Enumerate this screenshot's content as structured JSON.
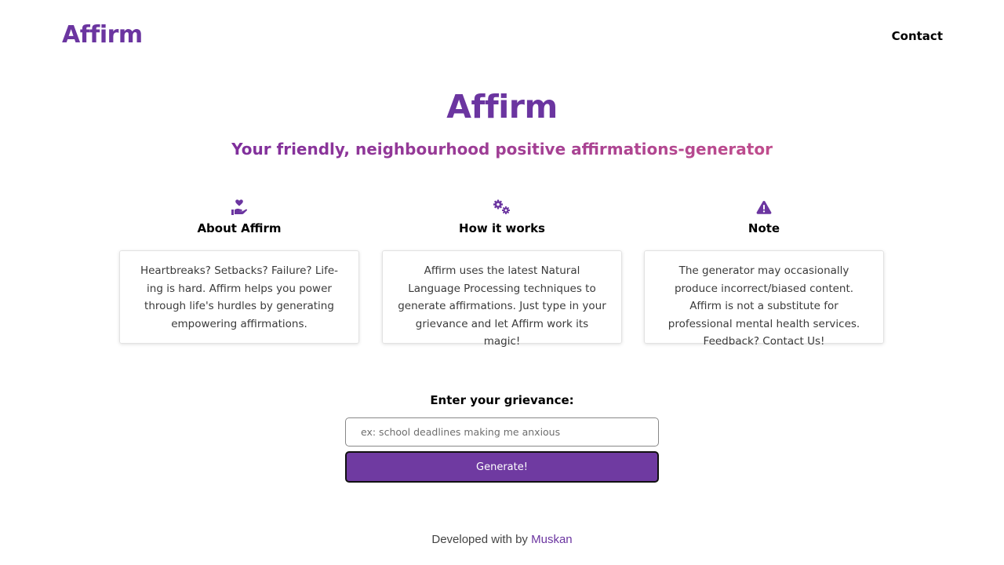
{
  "nav": {
    "brand": "Affirm",
    "contact": "Contact"
  },
  "hero": {
    "title": "Affirm",
    "subtitle": "Your friendly, neighbourhood positive affirmations-generator"
  },
  "features": [
    {
      "icon": "hand-holding-heart-icon",
      "heading": "About Affirm",
      "body": "Heartbreaks? Setbacks? Failure? Life-ing is hard. Affirm helps you power through life's hurdles by generating empowering affirmations."
    },
    {
      "icon": "cogs-icon",
      "heading": "How it works",
      "body": "Affirm uses the latest Natural Language Processing techniques to generate affirmations. Just type in your grievance and let Affirm work its magic!"
    },
    {
      "icon": "warning-icon",
      "heading": "Note",
      "body": "The generator may occasionally produce incorrect/biased content. Affirm is not a substitute for professional mental health services. Feedback? Contact Us!"
    }
  ],
  "form": {
    "label": "Enter your grievance:",
    "value": "",
    "placeholder": "ex: school deadlines making me anxious",
    "button": "Generate!"
  },
  "footer": {
    "prefix": "Developed with",
    "heart_glyph": "",
    "by": "by",
    "author": "Muskan"
  },
  "colors": {
    "brand": "#6b35a0",
    "button": "#6f3aa1",
    "subtitle_gradient": [
      "#7f2f9c",
      "#c04d8d"
    ]
  }
}
